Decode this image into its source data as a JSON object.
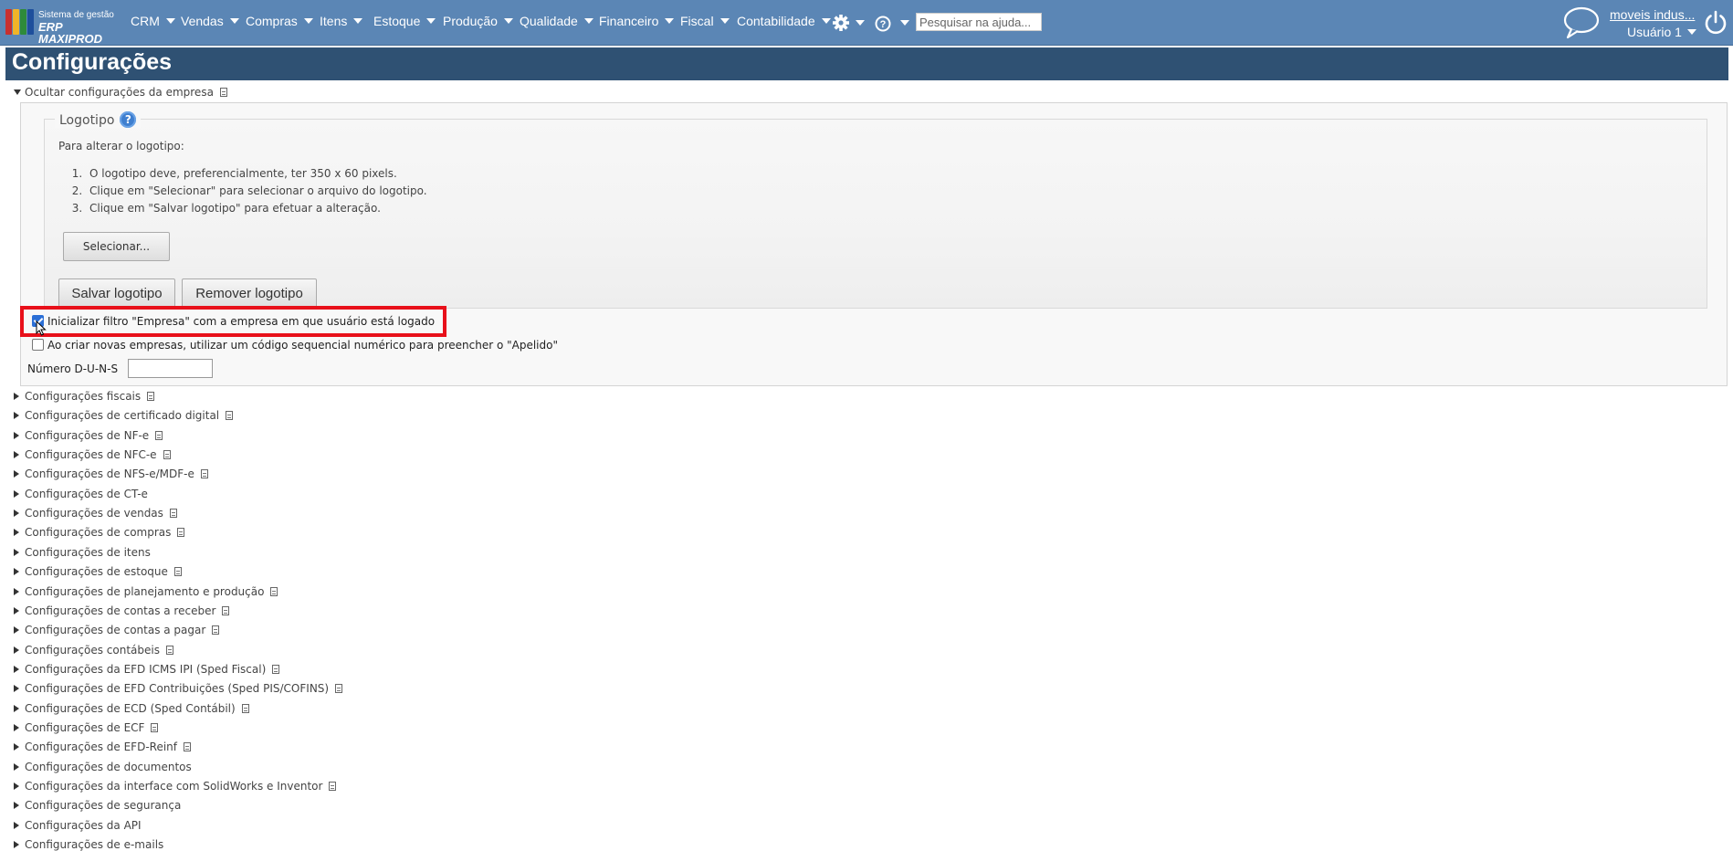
{
  "app": {
    "logo_line1": "Sistema de gestão",
    "logo_line2": "ERP MAXIPROD",
    "colors": {
      "topbar": "#5b86b5",
      "title_bar": "#2f5173",
      "highlight": "#e8101a",
      "checkbox": "#2b6fd6"
    }
  },
  "topbar": {
    "menu": [
      "CRM",
      "Vendas",
      "Compras",
      "Itens",
      "Estoque",
      "Produção",
      "Qualidade",
      "Financeiro",
      "Fiscal",
      "Contabilidade"
    ],
    "icons": [
      "gear-icon",
      "help-icon",
      "chat-bubble-icon",
      "power-icon"
    ],
    "search_placeholder": "Pesquisar na ajuda...",
    "company": "moveis indus...",
    "user": "Usuário 1"
  },
  "page": {
    "title": "Configurações"
  },
  "company_config": {
    "toggle_label": "Ocultar configurações da empresa",
    "logo": {
      "legend": "Logotipo",
      "help_glyph": "?",
      "intro": "Para alterar o logotipo:",
      "steps": [
        "O logotipo deve, preferencialmente, ter 350 x 60 pixels.",
        "Clique em \"Selecionar\" para selecionar o arquivo do logotipo.",
        "Clique em \"Salvar logotipo\" para efetuar a alteração."
      ],
      "select_label": "Selecionar...",
      "save_label": "Salvar logotipo",
      "remove_label": "Remover logotipo"
    },
    "options": [
      {
        "label": "Inicializar filtro \"Empresa\" com a empresa em que usuário está logado",
        "checked": true
      },
      {
        "label": "Ao criar novas empresas, utilizar um código sequencial numérico para preencher o \"Apelido\"",
        "checked": false
      }
    ],
    "duns_label": "Número D-U-N-S",
    "duns_value": ""
  },
  "sections": [
    {
      "label": "Configurações fiscais",
      "doc": true
    },
    {
      "label": "Configurações de certificado digital",
      "doc": true
    },
    {
      "label": "Configurações de NF-e",
      "doc": true
    },
    {
      "label": "Configurações de NFC-e",
      "doc": true
    },
    {
      "label": "Configurações de NFS-e/MDF-e",
      "doc": true
    },
    {
      "label": "Configurações de CT-e",
      "doc": false
    },
    {
      "label": "Configurações de vendas",
      "doc": true
    },
    {
      "label": "Configurações de compras",
      "doc": true
    },
    {
      "label": "Configurações de itens",
      "doc": false
    },
    {
      "label": "Configurações de estoque",
      "doc": true
    },
    {
      "label": "Configurações de planejamento e produção",
      "doc": true
    },
    {
      "label": "Configurações de contas a receber",
      "doc": true
    },
    {
      "label": "Configurações de contas a pagar",
      "doc": true
    },
    {
      "label": "Configurações contábeis",
      "doc": true
    },
    {
      "label": "Configurações da EFD ICMS IPI (Sped Fiscal)",
      "doc": true
    },
    {
      "label": "Configurações de EFD Contribuições (Sped PIS/COFINS)",
      "doc": true
    },
    {
      "label": "Configurações de ECD (Sped Contábil)",
      "doc": true
    },
    {
      "label": "Configurações de ECF",
      "doc": true
    },
    {
      "label": "Configurações de EFD-Reinf",
      "doc": true
    },
    {
      "label": "Configurações de documentos",
      "doc": false
    },
    {
      "label": "Configurações da interface com SolidWorks e Inventor",
      "doc": true
    },
    {
      "label": "Configurações de segurança",
      "doc": false
    },
    {
      "label": "Configurações da API",
      "doc": false
    },
    {
      "label": "Configurações de e-mails",
      "doc": false
    }
  ]
}
